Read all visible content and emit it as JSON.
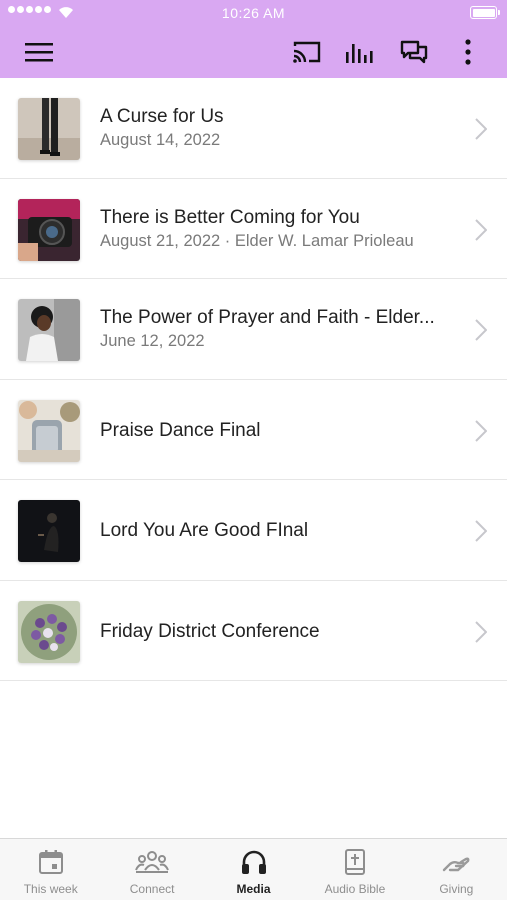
{
  "status_bar": {
    "time": "10:26 AM"
  },
  "app_bar": {
    "menu_icon": "hamburger-icon",
    "actions": [
      "cast-icon",
      "audio-bars-icon",
      "chat-icon",
      "more-vertical-icon"
    ],
    "background_color": "#d9a8f2"
  },
  "media_list": [
    {
      "title": "A Curse for Us",
      "subtitle": "August 14, 2022"
    },
    {
      "title": "There is Better Coming for You",
      "subtitle": "August 21, 2022 · Elder W. Lamar Prioleau"
    },
    {
      "title": "The Power of Prayer and Faith - Elder...",
      "subtitle": "June 12, 2022"
    },
    {
      "title": "Praise Dance Final",
      "subtitle": ""
    },
    {
      "title": "Lord You Are Good FInal",
      "subtitle": ""
    },
    {
      "title": "Friday District Conference",
      "subtitle": ""
    }
  ],
  "tab_bar": {
    "tabs": [
      {
        "label": "This week",
        "icon": "calendar-icon",
        "active": false
      },
      {
        "label": "Connect",
        "icon": "people-icon",
        "active": false
      },
      {
        "label": "Media",
        "icon": "headphones-icon",
        "active": true
      },
      {
        "label": "Audio Bible",
        "icon": "bible-icon",
        "active": false
      },
      {
        "label": "Giving",
        "icon": "giving-hand-icon",
        "active": false
      }
    ]
  }
}
